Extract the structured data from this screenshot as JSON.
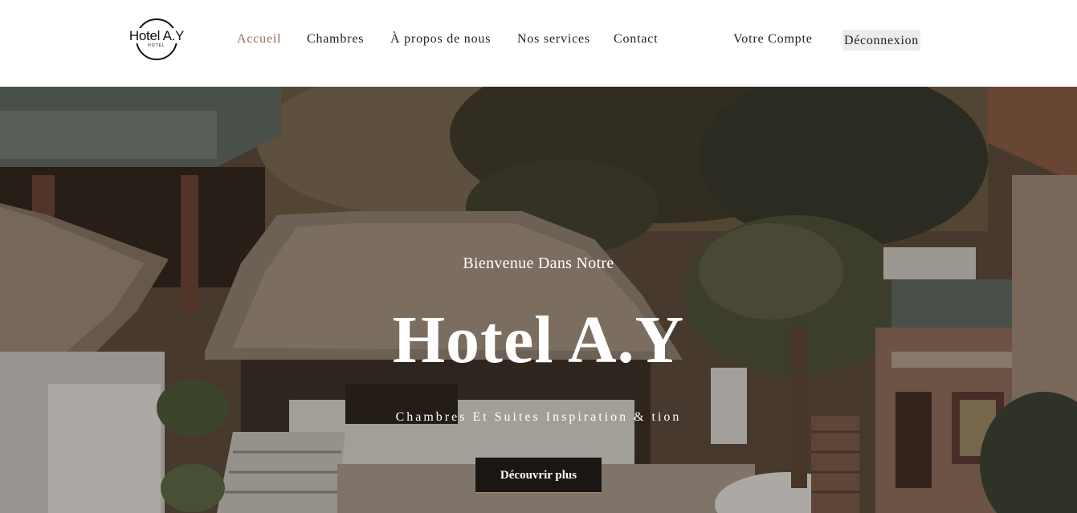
{
  "logo": {
    "text": "Hotel A.Y",
    "subtext": "HOTEL"
  },
  "nav": {
    "items": [
      {
        "label": "Accueil",
        "active": true
      },
      {
        "label": "Chambres",
        "active": false
      },
      {
        "label": "À propos de nous",
        "active": false
      },
      {
        "label": "Nos services",
        "active": false
      },
      {
        "label": "Contact",
        "active": false
      }
    ],
    "account_label": "Votre Compte",
    "logout_label": "Déconnexion"
  },
  "hero": {
    "intro": "Bienvenue Dans Notre",
    "title": "Hotel A.Y",
    "tagline": "Chambres Et Suites Inspiration & tion",
    "cta_label": "Découvrir plus"
  },
  "colors": {
    "nav_active": "#9a6a5c",
    "nav_text": "#222222",
    "cta_background": "#1b1613",
    "logout_background": "#ececec"
  }
}
